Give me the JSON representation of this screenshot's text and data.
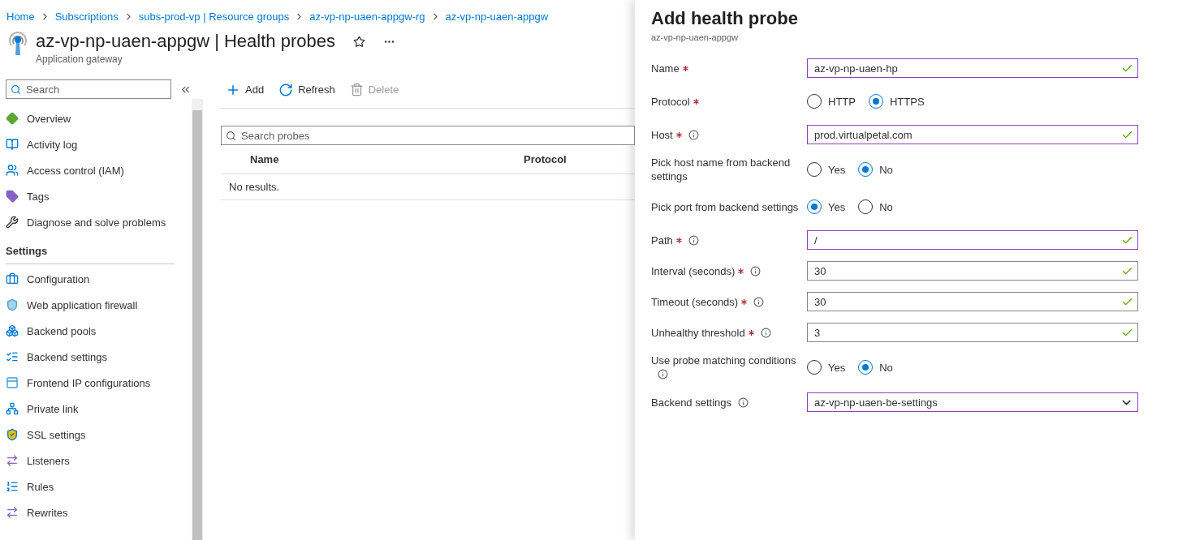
{
  "breadcrumb": [
    "Home",
    "Subscriptions",
    "subs-prod-vp | Resource groups",
    "az-vp-np-uaen-appgw-rg",
    "az-vp-np-uaen-appgw"
  ],
  "header": {
    "title": "az-vp-np-uaen-appgw | Health probes",
    "subtitle": "Application gateway"
  },
  "sidebar": {
    "search": {
      "placeholder": "Search"
    },
    "items": [
      {
        "label": "Overview"
      },
      {
        "label": "Activity log"
      },
      {
        "label": "Access control (IAM)"
      },
      {
        "label": "Tags"
      },
      {
        "label": "Diagnose and solve problems"
      }
    ],
    "section": {
      "title": "Settings",
      "items": [
        {
          "label": "Configuration"
        },
        {
          "label": "Web application firewall"
        },
        {
          "label": "Backend pools"
        },
        {
          "label": "Backend settings"
        },
        {
          "label": "Frontend IP configurations"
        },
        {
          "label": "Private link"
        },
        {
          "label": "SSL settings"
        },
        {
          "label": "Listeners"
        },
        {
          "label": "Rules"
        },
        {
          "label": "Rewrites"
        }
      ]
    }
  },
  "toolbar": [
    {
      "kind": "add",
      "label": "Add",
      "disabled": false
    },
    {
      "kind": "refresh",
      "label": "Refresh",
      "disabled": false
    },
    {
      "kind": "delete",
      "label": "Delete",
      "disabled": true
    }
  ],
  "search": {
    "placeholder": "Search probes"
  },
  "table": {
    "columns": [
      "Name",
      "Protocol"
    ],
    "empty_text": "No results."
  },
  "panel": {
    "title": "Add health probe",
    "subtitle": "az-vp-np-uaen-appgw",
    "fields": [
      {
        "kind": "input",
        "label": "Name",
        "required": true,
        "info": false,
        "value": "az-vp-np-uaen-hp",
        "highlighted": true,
        "valid": true
      },
      {
        "kind": "radio",
        "label": "Protocol",
        "required": true,
        "info": false,
        "options": [
          {
            "label": "HTTP",
            "selected": false
          },
          {
            "label": "HTTPS",
            "selected": true
          }
        ]
      },
      {
        "kind": "input",
        "label": "Host",
        "required": true,
        "info": true,
        "value": "prod.virtualpetal.com",
        "highlighted": true,
        "valid": true
      },
      {
        "kind": "radio",
        "label": "Pick host name from backend settings",
        "required": false,
        "info": false,
        "options": [
          {
            "label": "Yes",
            "selected": false
          },
          {
            "label": "No",
            "selected": true
          }
        ]
      },
      {
        "kind": "radio",
        "label": "Pick port from backend settings",
        "required": false,
        "info": false,
        "options": [
          {
            "label": "Yes",
            "selected": true
          },
          {
            "label": "No",
            "selected": false
          }
        ]
      },
      {
        "kind": "input",
        "label": "Path",
        "required": true,
        "info": true,
        "value": "/",
        "highlighted": true,
        "valid": true
      },
      {
        "kind": "input",
        "label": "Interval (seconds)",
        "required": true,
        "info": true,
        "value": "30",
        "highlighted": false,
        "valid": true
      },
      {
        "kind": "input",
        "label": "Timeout (seconds)",
        "required": true,
        "info": true,
        "value": "30",
        "highlighted": false,
        "valid": true
      },
      {
        "kind": "input",
        "label": "Unhealthy threshold",
        "required": true,
        "info": true,
        "value": "3",
        "highlighted": false,
        "valid": true
      },
      {
        "kind": "radio",
        "label": "Use probe matching conditions",
        "required": false,
        "info": true,
        "options": [
          {
            "label": "Yes",
            "selected": false
          },
          {
            "label": "No",
            "selected": true
          }
        ]
      },
      {
        "kind": "select",
        "label": "Backend settings",
        "required": false,
        "info": true,
        "value": "az-vp-np-uaen-be-settings",
        "highlighted": true
      }
    ]
  }
}
